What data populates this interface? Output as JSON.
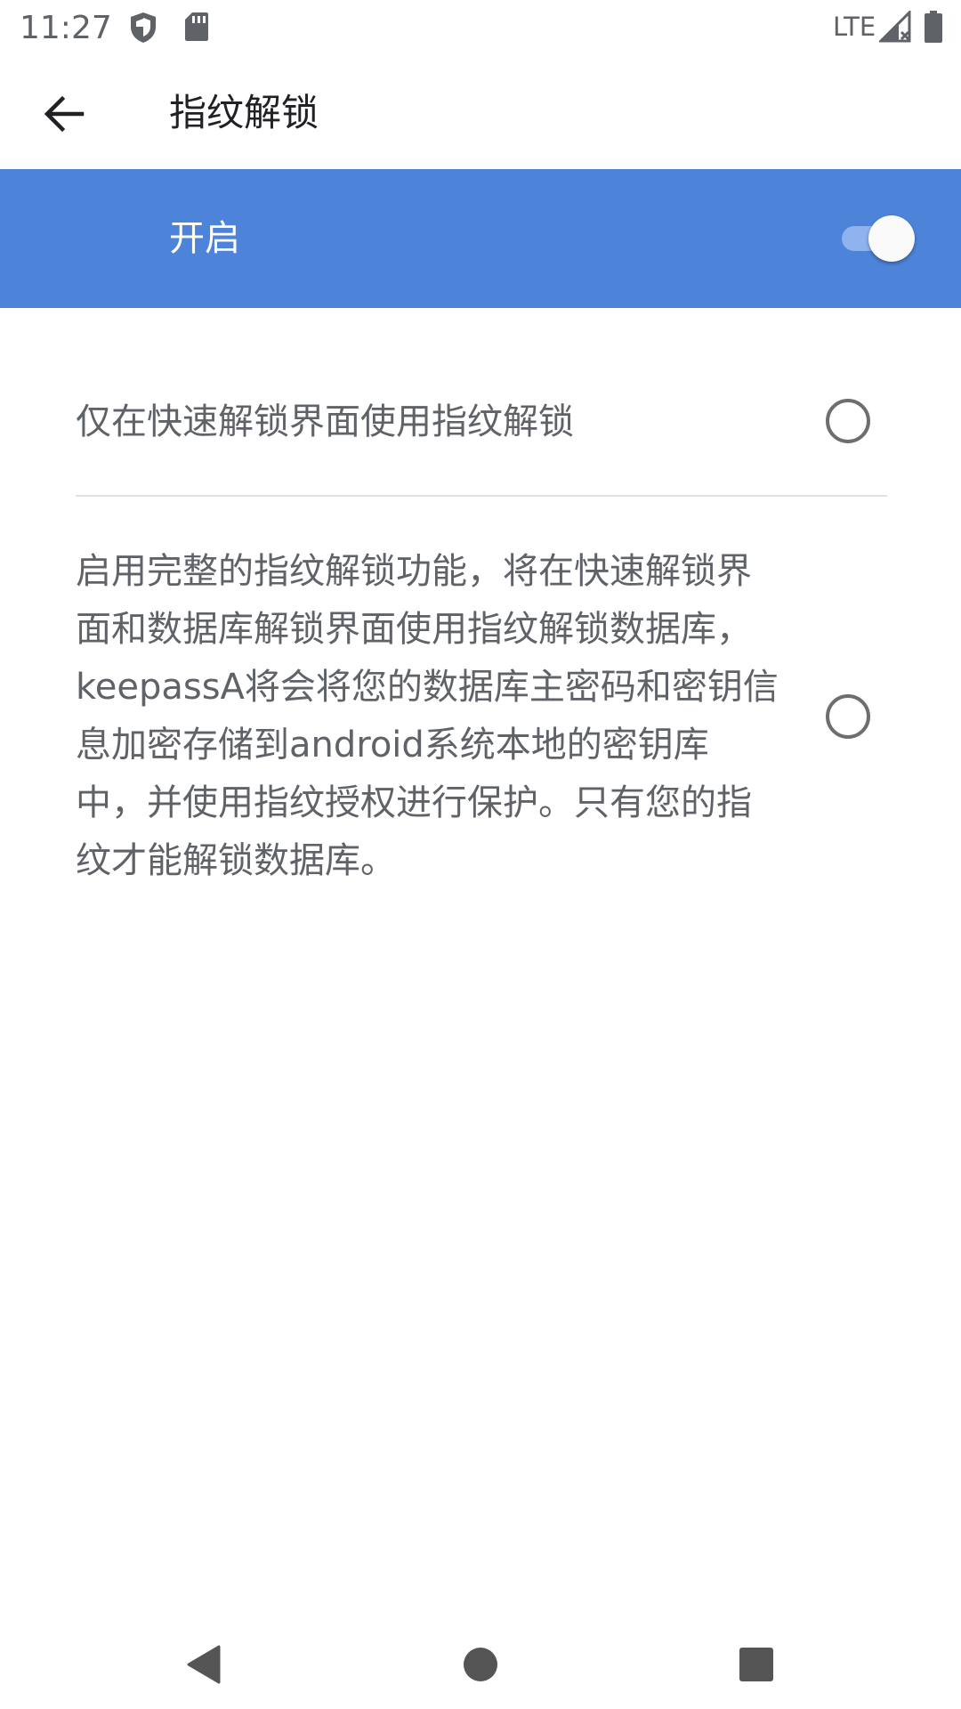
{
  "status_bar": {
    "time": "11:27",
    "network": "LTE",
    "icons": [
      "shield-icon",
      "sd-card-icon",
      "signal-icon",
      "battery-icon"
    ]
  },
  "app_bar": {
    "title": "指纹解锁",
    "back_icon": "arrow-back-icon"
  },
  "master_switch": {
    "label": "开启",
    "enabled": true,
    "background_color": "#4d84d9"
  },
  "options": [
    {
      "text": "仅在快速解锁界面使用指纹解锁",
      "selected": false
    },
    {
      "text": "启用完整的指纹解锁功能，将在快速解锁界面和数据库解锁界面使用指纹解锁数据库，keepassA将会将您的数据库主密码和密钥信息加密存储到android系统本地的密钥库中，并使用指纹授权进行保护。只有您的指纹才能解锁数据库。",
      "selected": false
    }
  ],
  "nav_bar": {
    "icons": [
      "nav-back-icon",
      "nav-home-icon",
      "nav-recents-icon"
    ]
  }
}
